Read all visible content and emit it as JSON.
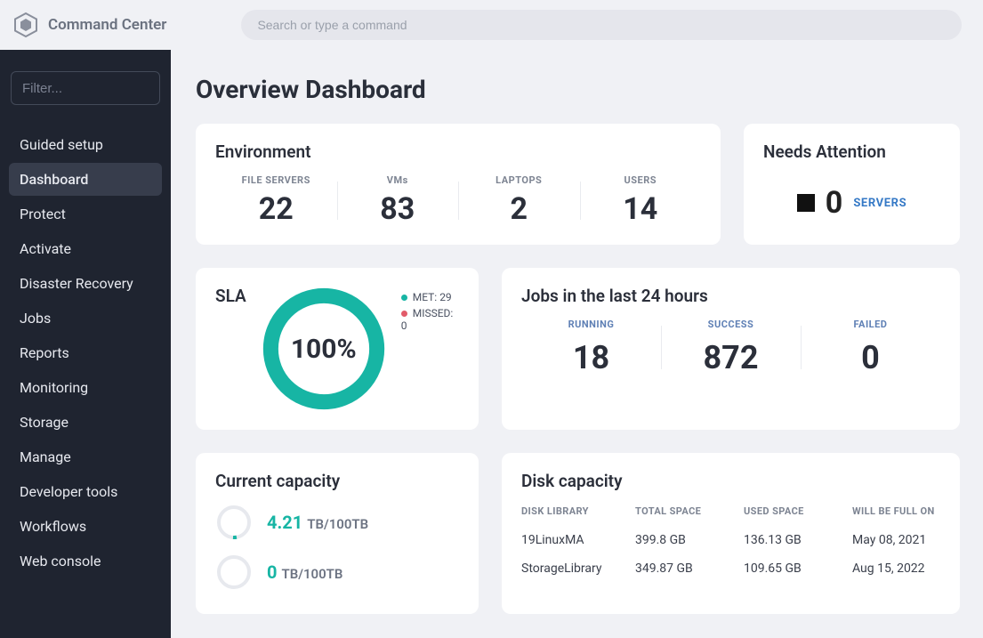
{
  "app": {
    "title": "Command Center"
  },
  "search": {
    "placeholder": "Search or type a command"
  },
  "sidebar": {
    "filter_placeholder": "Filter...",
    "items": [
      {
        "label": "Guided setup",
        "active": false
      },
      {
        "label": "Dashboard",
        "active": true
      },
      {
        "label": "Protect",
        "active": false
      },
      {
        "label": "Activate",
        "active": false
      },
      {
        "label": "Disaster Recovery",
        "active": false
      },
      {
        "label": "Jobs",
        "active": false
      },
      {
        "label": "Reports",
        "active": false
      },
      {
        "label": "Monitoring",
        "active": false
      },
      {
        "label": "Storage",
        "active": false
      },
      {
        "label": "Manage",
        "active": false
      },
      {
        "label": "Developer tools",
        "active": false
      },
      {
        "label": "Workflows",
        "active": false
      },
      {
        "label": "Web console",
        "active": false
      }
    ]
  },
  "page": {
    "title": "Overview Dashboard"
  },
  "environment": {
    "title": "Environment",
    "stats": [
      {
        "label": "FILE SERVERS",
        "value": "22"
      },
      {
        "label": "VMs",
        "value": "83"
      },
      {
        "label": "LAPTOPS",
        "value": "2"
      },
      {
        "label": "USERS",
        "value": "14"
      }
    ]
  },
  "attention": {
    "title": "Needs Attention",
    "count": "0",
    "link_label": "SERVERS"
  },
  "sla": {
    "title": "SLA",
    "percent_label": "100%",
    "legend": {
      "met_label": "MET: 29",
      "missed_label": "MISSED: 0"
    }
  },
  "jobs": {
    "title": "Jobs in the last 24 hours",
    "stats": [
      {
        "label": "RUNNING",
        "value": "18"
      },
      {
        "label": "SUCCESS",
        "value": "872"
      },
      {
        "label": "FAILED",
        "value": "0"
      }
    ]
  },
  "current_capacity": {
    "title": "Current capacity",
    "rows": [
      {
        "value": "4.21",
        "value_unit": "TB",
        "sep": "/",
        "total": "100",
        "total_unit": "TB",
        "color": "teal"
      },
      {
        "value": "0",
        "value_unit": "TB",
        "sep": "/",
        "total": "100",
        "total_unit": "TB",
        "color": "zero"
      }
    ]
  },
  "disk_capacity": {
    "title": "Disk capacity",
    "columns": [
      "DISK LIBRARY",
      "TOTAL SPACE",
      "USED SPACE",
      "WILL BE FULL ON"
    ],
    "rows": [
      {
        "c0": "19LinuxMA",
        "c1": "399.8 GB",
        "c2": "136.13 GB",
        "c3": "May 08, 2021"
      },
      {
        "c0": "StorageLibrary",
        "c1": "349.87 GB",
        "c2": "109.65 GB",
        "c3": "Aug 15, 2022"
      }
    ]
  },
  "colors": {
    "teal": "#17b5a4",
    "ring_bg": "#e7e9ee"
  }
}
